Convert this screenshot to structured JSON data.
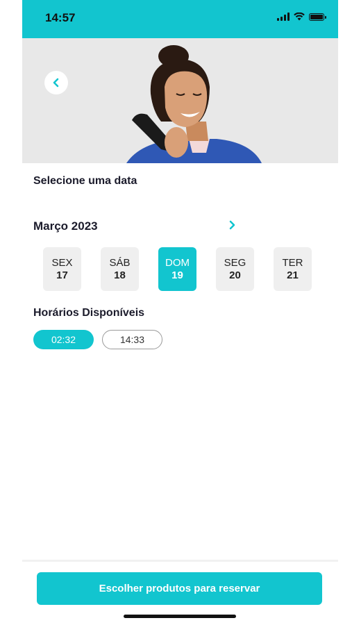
{
  "status_bar": {
    "time": "14:57"
  },
  "header": {
    "back_icon": "chevron-left-icon"
  },
  "date_section": {
    "title": "Selecione uma data"
  },
  "calendar": {
    "month": "Março 2023",
    "next_icon": "chevron-right-icon",
    "days": [
      {
        "name": "SEX",
        "num": "17",
        "selected": false
      },
      {
        "name": "SÁB",
        "num": "18",
        "selected": false
      },
      {
        "name": "DOM",
        "num": "19",
        "selected": true
      },
      {
        "name": "SEG",
        "num": "20",
        "selected": false
      },
      {
        "name": "TER",
        "num": "21",
        "selected": false
      }
    ]
  },
  "times_section": {
    "title": "Horários Disponíveis",
    "slots": [
      {
        "label": "02:32",
        "selected": true
      },
      {
        "label": "14:33",
        "selected": false
      }
    ]
  },
  "footer": {
    "cta_label": "Escolher produtos para reservar"
  },
  "colors": {
    "accent": "#12c5cf",
    "text": "#1b1b2b",
    "chip_bg": "#efefef"
  }
}
